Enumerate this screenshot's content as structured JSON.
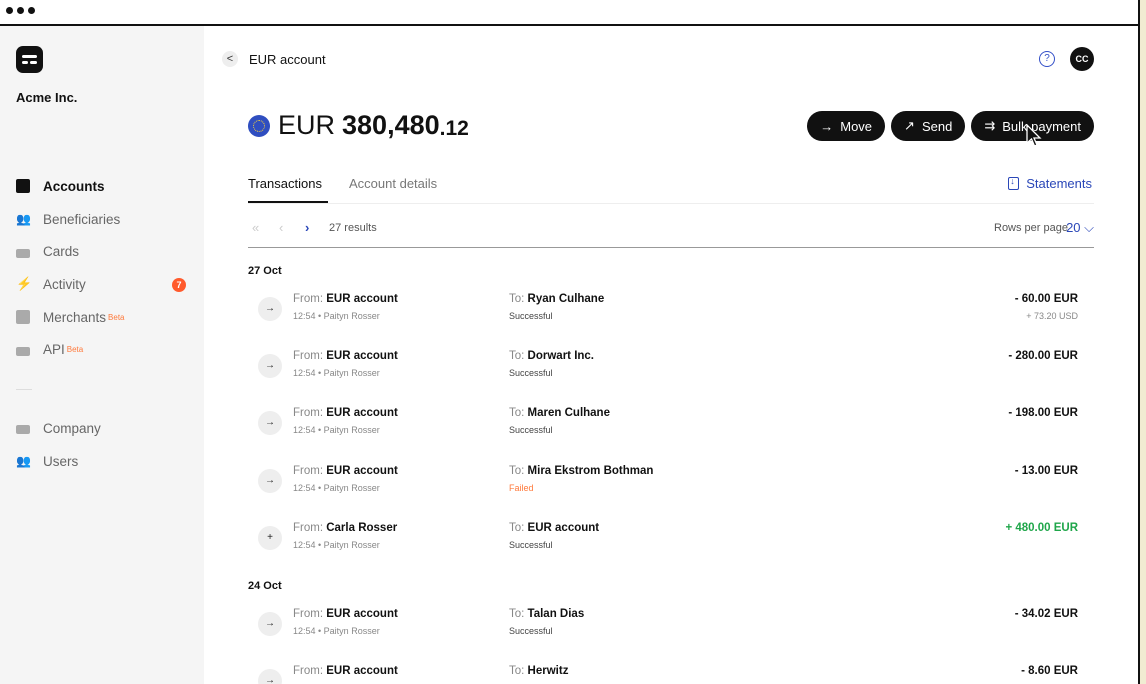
{
  "org": {
    "name": "Acme Inc."
  },
  "sidebar": {
    "items": [
      {
        "label": "Accounts",
        "icon": "box-icon"
      },
      {
        "label": "Beneficiaries",
        "icon": "people-icon"
      },
      {
        "label": "Cards",
        "icon": "card-icon"
      },
      {
        "label": "Activity",
        "icon": "bolt-icon",
        "badge": "7"
      },
      {
        "label": "Merchants",
        "icon": "bag-icon",
        "tag": "Beta"
      },
      {
        "label": "API",
        "icon": "api-icon",
        "tag": "Beta"
      }
    ],
    "bottom": [
      {
        "label": "Company",
        "icon": "building-icon"
      },
      {
        "label": "Users",
        "icon": "users-icon"
      }
    ]
  },
  "header": {
    "breadcrumb": "EUR account",
    "back": "<",
    "help": "?",
    "avatar": "CC"
  },
  "balance": {
    "currency": "EUR",
    "integer": "380,480",
    "decimal": ".12"
  },
  "actions": [
    {
      "glyph": "→",
      "label": "Move"
    },
    {
      "glyph": "↗",
      "label": "Send"
    },
    {
      "glyph": "⇉",
      "label": "Bulk payment"
    }
  ],
  "tabs": {
    "items": [
      "Transactions",
      "Account details"
    ],
    "statements": "Statements"
  },
  "pager": {
    "first": "«",
    "prev": "‹",
    "next": "›",
    "results": "27 results",
    "rows_label": "Rows per page",
    "rows_value": "20 ⌵"
  },
  "groups": [
    {
      "date": "27 Oct",
      "transactions": [
        {
          "glyph": "→",
          "from_label": "From:",
          "from": "EUR account",
          "meta": "12:54 • Paityn Rosser",
          "to_label": "To:",
          "to": "Ryan Culhane",
          "status": "Successful",
          "amount": "- 60.00 EUR",
          "sub": "+ 73.20 USD"
        },
        {
          "glyph": "→",
          "from_label": "From:",
          "from": "EUR account",
          "meta": "12:54 • Paityn Rosser",
          "to_label": "To:",
          "to": "Dorwart Inc.",
          "status": "Successful",
          "amount": "- 280.00 EUR",
          "sub": ""
        },
        {
          "glyph": "→",
          "from_label": "From:",
          "from": "EUR account",
          "meta": "12:54 • Paityn Rosser",
          "to_label": "To:",
          "to": "Maren Culhane",
          "status": "Successful",
          "amount": "- 198.00 EUR",
          "sub": ""
        },
        {
          "glyph": "→",
          "from_label": "From:",
          "from": "EUR account",
          "meta": "12:54 • Paityn Rosser",
          "to_label": "To:",
          "to": "Mira Ekstrom Bothman",
          "status": "Failed",
          "amount": "- 13.00 EUR",
          "sub": ""
        },
        {
          "glyph": "+",
          "from_label": "From:",
          "from": "Carla Rosser",
          "meta": "12:54 • Paityn Rosser",
          "to_label": "To:",
          "to": "EUR account",
          "status": "Successful",
          "amount": "+ 480.00 EUR",
          "sub": ""
        }
      ]
    },
    {
      "date": "24 Oct",
      "transactions": [
        {
          "glyph": "→",
          "from_label": "From:",
          "from": "EUR account",
          "meta": "12:54 • Paityn Rosser",
          "to_label": "To:",
          "to": "Talan Dias",
          "status": "Successful",
          "amount": "- 34.02 EUR",
          "sub": ""
        },
        {
          "glyph": "→",
          "from_label": "From:",
          "from": "EUR account",
          "meta": "",
          "to_label": "To:",
          "to": "Herwitz",
          "status": "",
          "amount": "- 8.60 EUR",
          "sub": ""
        }
      ]
    }
  ],
  "colors": {
    "accent": "#2a47b8",
    "positive": "#1fa64a",
    "failed": "#ff7a3c",
    "badge": "#ff5a2c"
  }
}
